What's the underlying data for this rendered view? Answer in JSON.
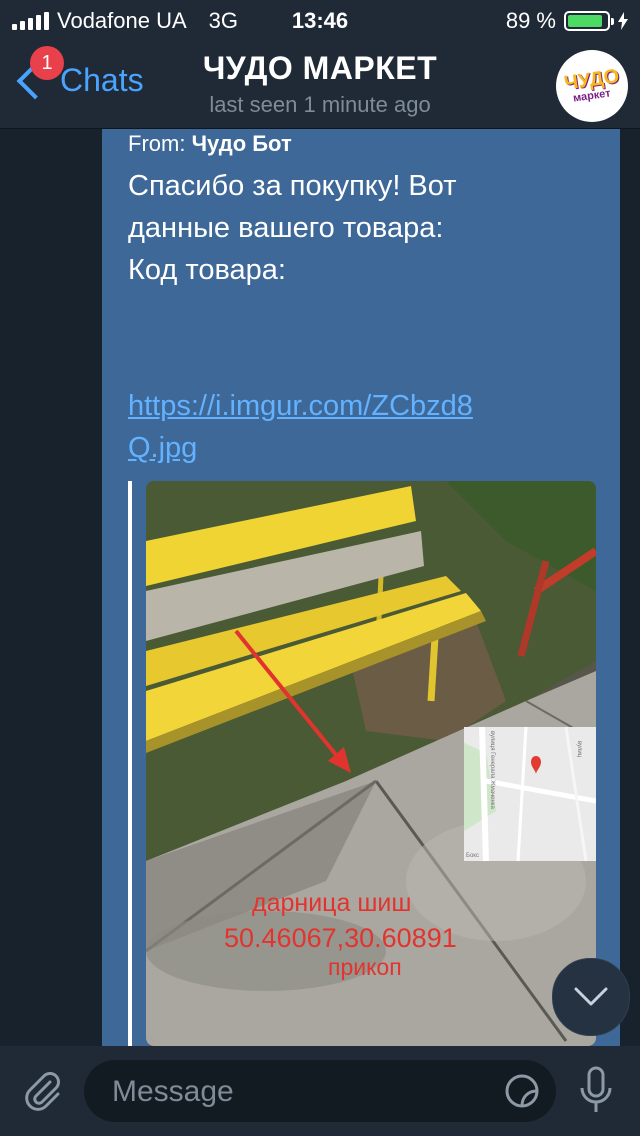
{
  "status_bar": {
    "carrier": "Vodafone UA",
    "network": "3G",
    "time": "13:46",
    "battery": "89 %",
    "battery_level": 0.89
  },
  "header": {
    "back_label": "Chats",
    "unread_badge": "1",
    "title": "ЧУДО МАРКЕТ",
    "subtitle": "last seen 1 minute ago",
    "avatar_text_top": "ЧУДО",
    "avatar_text_bottom": "маркет"
  },
  "message": {
    "from_prefix": "From:",
    "from_name": "Чудо Бот",
    "text": "Спасибо за покупку! Вот\nданные вашего товара:\nКод товара:",
    "link": "https://i.imgur.com/ZCbzd8Q.jpg",
    "photo_caption": {
      "line1": "дарница шиш",
      "line2": "50.46067,30.60891",
      "line3": "прикоп"
    },
    "map_labels": {
      "street_1": "вулиця Генерала Жмаченка",
      "street_2": "вулиц",
      "place": "Бокс"
    }
  },
  "input": {
    "placeholder": "Message"
  },
  "icons": {
    "attach": "paperclip-icon",
    "sticker": "sticker-icon",
    "mic": "microphone-icon",
    "scroll": "chevron-down-icon",
    "back": "chevron-left-icon"
  },
  "colors": {
    "accent": "#4aa3ff",
    "bubble": "#3e6897",
    "badge": "#e8414b",
    "battery": "#4cd964",
    "caption": "#e2342f"
  }
}
